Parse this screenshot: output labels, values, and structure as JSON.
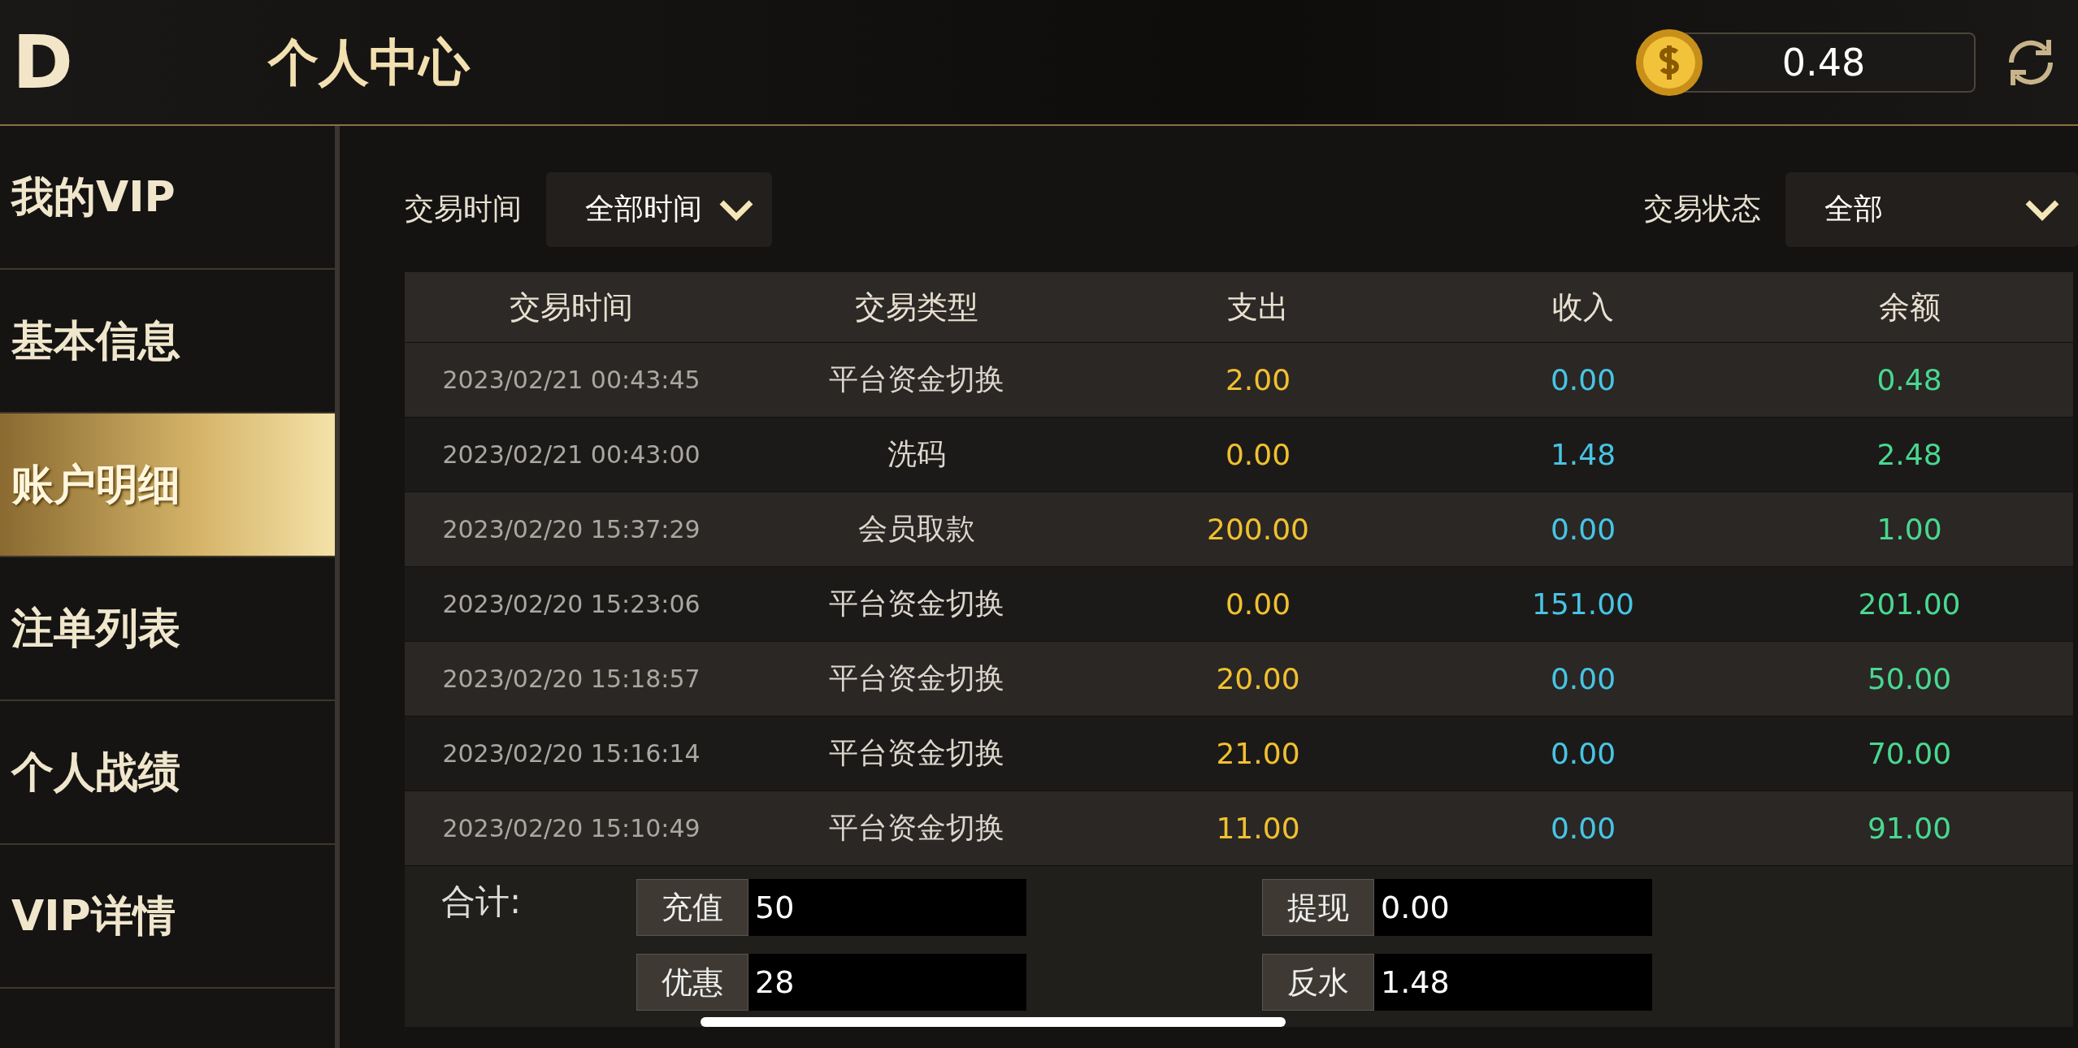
{
  "header": {
    "back": "D",
    "title": "个人中心",
    "balance": "0.48"
  },
  "sidebar": {
    "items": [
      {
        "label": "我的VIP",
        "selected": false
      },
      {
        "label": "基本信息",
        "selected": false
      },
      {
        "label": "账户明细",
        "selected": true
      },
      {
        "label": "注单列表",
        "selected": false
      },
      {
        "label": "个人战绩",
        "selected": false
      },
      {
        "label": "VIP详情",
        "selected": false
      }
    ]
  },
  "filters": [
    {
      "label": "交易时间",
      "value": "全部时间"
    },
    {
      "label": "交易状态",
      "value": "全部"
    }
  ],
  "table": {
    "columns": [
      "交易时间",
      "交易类型",
      "支出",
      "收入",
      "余额"
    ],
    "rows": [
      [
        "2023/02/21 00:43:45",
        "平台资金切换",
        "2.00",
        "0.00",
        "0.48"
      ],
      [
        "2023/02/21 00:43:00",
        "洗码",
        "0.00",
        "1.48",
        "2.48"
      ],
      [
        "2023/02/20 15:37:29",
        "会员取款",
        "200.00",
        "0.00",
        "1.00"
      ],
      [
        "2023/02/20 15:23:06",
        "平台资金切换",
        "0.00",
        "151.00",
        "201.00"
      ],
      [
        "2023/02/20 15:18:57",
        "平台资金切换",
        "20.00",
        "0.00",
        "50.00"
      ],
      [
        "2023/02/20 15:16:14",
        "平台资金切换",
        "21.00",
        "0.00",
        "70.00"
      ],
      [
        "2023/02/20 15:10:49",
        "平台资金切换",
        "11.00",
        "0.00",
        "91.00"
      ]
    ]
  },
  "totals": {
    "label": "合计:",
    "fields": [
      {
        "label": "充值",
        "value": "50"
      },
      {
        "label": "提现",
        "value": "0.00"
      },
      {
        "label": "优惠",
        "value": "28"
      },
      {
        "label": "反水",
        "value": "1.48"
      }
    ]
  }
}
